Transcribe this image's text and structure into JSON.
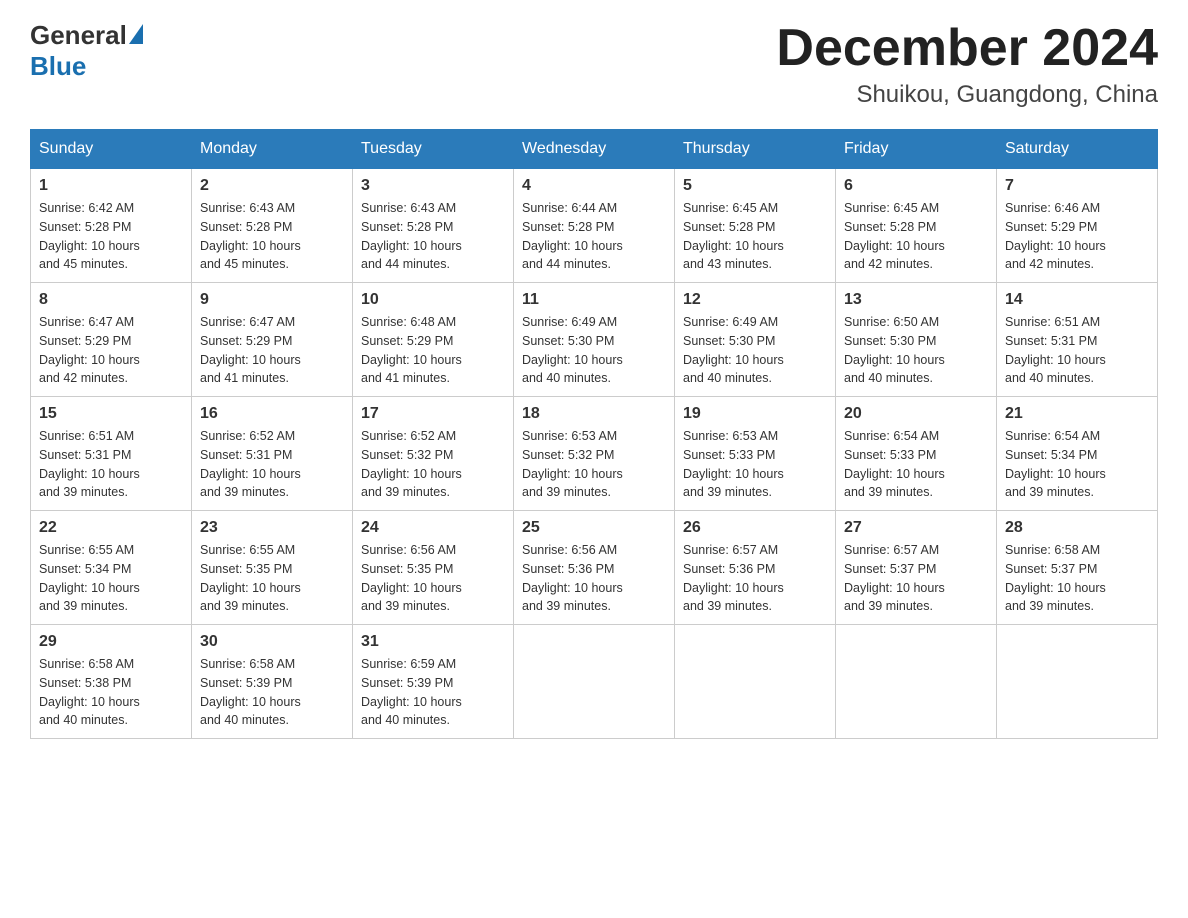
{
  "logo": {
    "text_general": "General",
    "text_blue": "Blue",
    "triangle_aria": "logo-triangle"
  },
  "title": "December 2024",
  "subtitle": "Shuikou, Guangdong, China",
  "days_of_week": [
    "Sunday",
    "Monday",
    "Tuesday",
    "Wednesday",
    "Thursday",
    "Friday",
    "Saturday"
  ],
  "weeks": [
    [
      {
        "day": "1",
        "info": "Sunrise: 6:42 AM\nSunset: 5:28 PM\nDaylight: 10 hours\nand 45 minutes."
      },
      {
        "day": "2",
        "info": "Sunrise: 6:43 AM\nSunset: 5:28 PM\nDaylight: 10 hours\nand 45 minutes."
      },
      {
        "day": "3",
        "info": "Sunrise: 6:43 AM\nSunset: 5:28 PM\nDaylight: 10 hours\nand 44 minutes."
      },
      {
        "day": "4",
        "info": "Sunrise: 6:44 AM\nSunset: 5:28 PM\nDaylight: 10 hours\nand 44 minutes."
      },
      {
        "day": "5",
        "info": "Sunrise: 6:45 AM\nSunset: 5:28 PM\nDaylight: 10 hours\nand 43 minutes."
      },
      {
        "day": "6",
        "info": "Sunrise: 6:45 AM\nSunset: 5:28 PM\nDaylight: 10 hours\nand 42 minutes."
      },
      {
        "day": "7",
        "info": "Sunrise: 6:46 AM\nSunset: 5:29 PM\nDaylight: 10 hours\nand 42 minutes."
      }
    ],
    [
      {
        "day": "8",
        "info": "Sunrise: 6:47 AM\nSunset: 5:29 PM\nDaylight: 10 hours\nand 42 minutes."
      },
      {
        "day": "9",
        "info": "Sunrise: 6:47 AM\nSunset: 5:29 PM\nDaylight: 10 hours\nand 41 minutes."
      },
      {
        "day": "10",
        "info": "Sunrise: 6:48 AM\nSunset: 5:29 PM\nDaylight: 10 hours\nand 41 minutes."
      },
      {
        "day": "11",
        "info": "Sunrise: 6:49 AM\nSunset: 5:30 PM\nDaylight: 10 hours\nand 40 minutes."
      },
      {
        "day": "12",
        "info": "Sunrise: 6:49 AM\nSunset: 5:30 PM\nDaylight: 10 hours\nand 40 minutes."
      },
      {
        "day": "13",
        "info": "Sunrise: 6:50 AM\nSunset: 5:30 PM\nDaylight: 10 hours\nand 40 minutes."
      },
      {
        "day": "14",
        "info": "Sunrise: 6:51 AM\nSunset: 5:31 PM\nDaylight: 10 hours\nand 40 minutes."
      }
    ],
    [
      {
        "day": "15",
        "info": "Sunrise: 6:51 AM\nSunset: 5:31 PM\nDaylight: 10 hours\nand 39 minutes."
      },
      {
        "day": "16",
        "info": "Sunrise: 6:52 AM\nSunset: 5:31 PM\nDaylight: 10 hours\nand 39 minutes."
      },
      {
        "day": "17",
        "info": "Sunrise: 6:52 AM\nSunset: 5:32 PM\nDaylight: 10 hours\nand 39 minutes."
      },
      {
        "day": "18",
        "info": "Sunrise: 6:53 AM\nSunset: 5:32 PM\nDaylight: 10 hours\nand 39 minutes."
      },
      {
        "day": "19",
        "info": "Sunrise: 6:53 AM\nSunset: 5:33 PM\nDaylight: 10 hours\nand 39 minutes."
      },
      {
        "day": "20",
        "info": "Sunrise: 6:54 AM\nSunset: 5:33 PM\nDaylight: 10 hours\nand 39 minutes."
      },
      {
        "day": "21",
        "info": "Sunrise: 6:54 AM\nSunset: 5:34 PM\nDaylight: 10 hours\nand 39 minutes."
      }
    ],
    [
      {
        "day": "22",
        "info": "Sunrise: 6:55 AM\nSunset: 5:34 PM\nDaylight: 10 hours\nand 39 minutes."
      },
      {
        "day": "23",
        "info": "Sunrise: 6:55 AM\nSunset: 5:35 PM\nDaylight: 10 hours\nand 39 minutes."
      },
      {
        "day": "24",
        "info": "Sunrise: 6:56 AM\nSunset: 5:35 PM\nDaylight: 10 hours\nand 39 minutes."
      },
      {
        "day": "25",
        "info": "Sunrise: 6:56 AM\nSunset: 5:36 PM\nDaylight: 10 hours\nand 39 minutes."
      },
      {
        "day": "26",
        "info": "Sunrise: 6:57 AM\nSunset: 5:36 PM\nDaylight: 10 hours\nand 39 minutes."
      },
      {
        "day": "27",
        "info": "Sunrise: 6:57 AM\nSunset: 5:37 PM\nDaylight: 10 hours\nand 39 minutes."
      },
      {
        "day": "28",
        "info": "Sunrise: 6:58 AM\nSunset: 5:37 PM\nDaylight: 10 hours\nand 39 minutes."
      }
    ],
    [
      {
        "day": "29",
        "info": "Sunrise: 6:58 AM\nSunset: 5:38 PM\nDaylight: 10 hours\nand 40 minutes."
      },
      {
        "day": "30",
        "info": "Sunrise: 6:58 AM\nSunset: 5:39 PM\nDaylight: 10 hours\nand 40 minutes."
      },
      {
        "day": "31",
        "info": "Sunrise: 6:59 AM\nSunset: 5:39 PM\nDaylight: 10 hours\nand 40 minutes."
      },
      null,
      null,
      null,
      null
    ]
  ]
}
